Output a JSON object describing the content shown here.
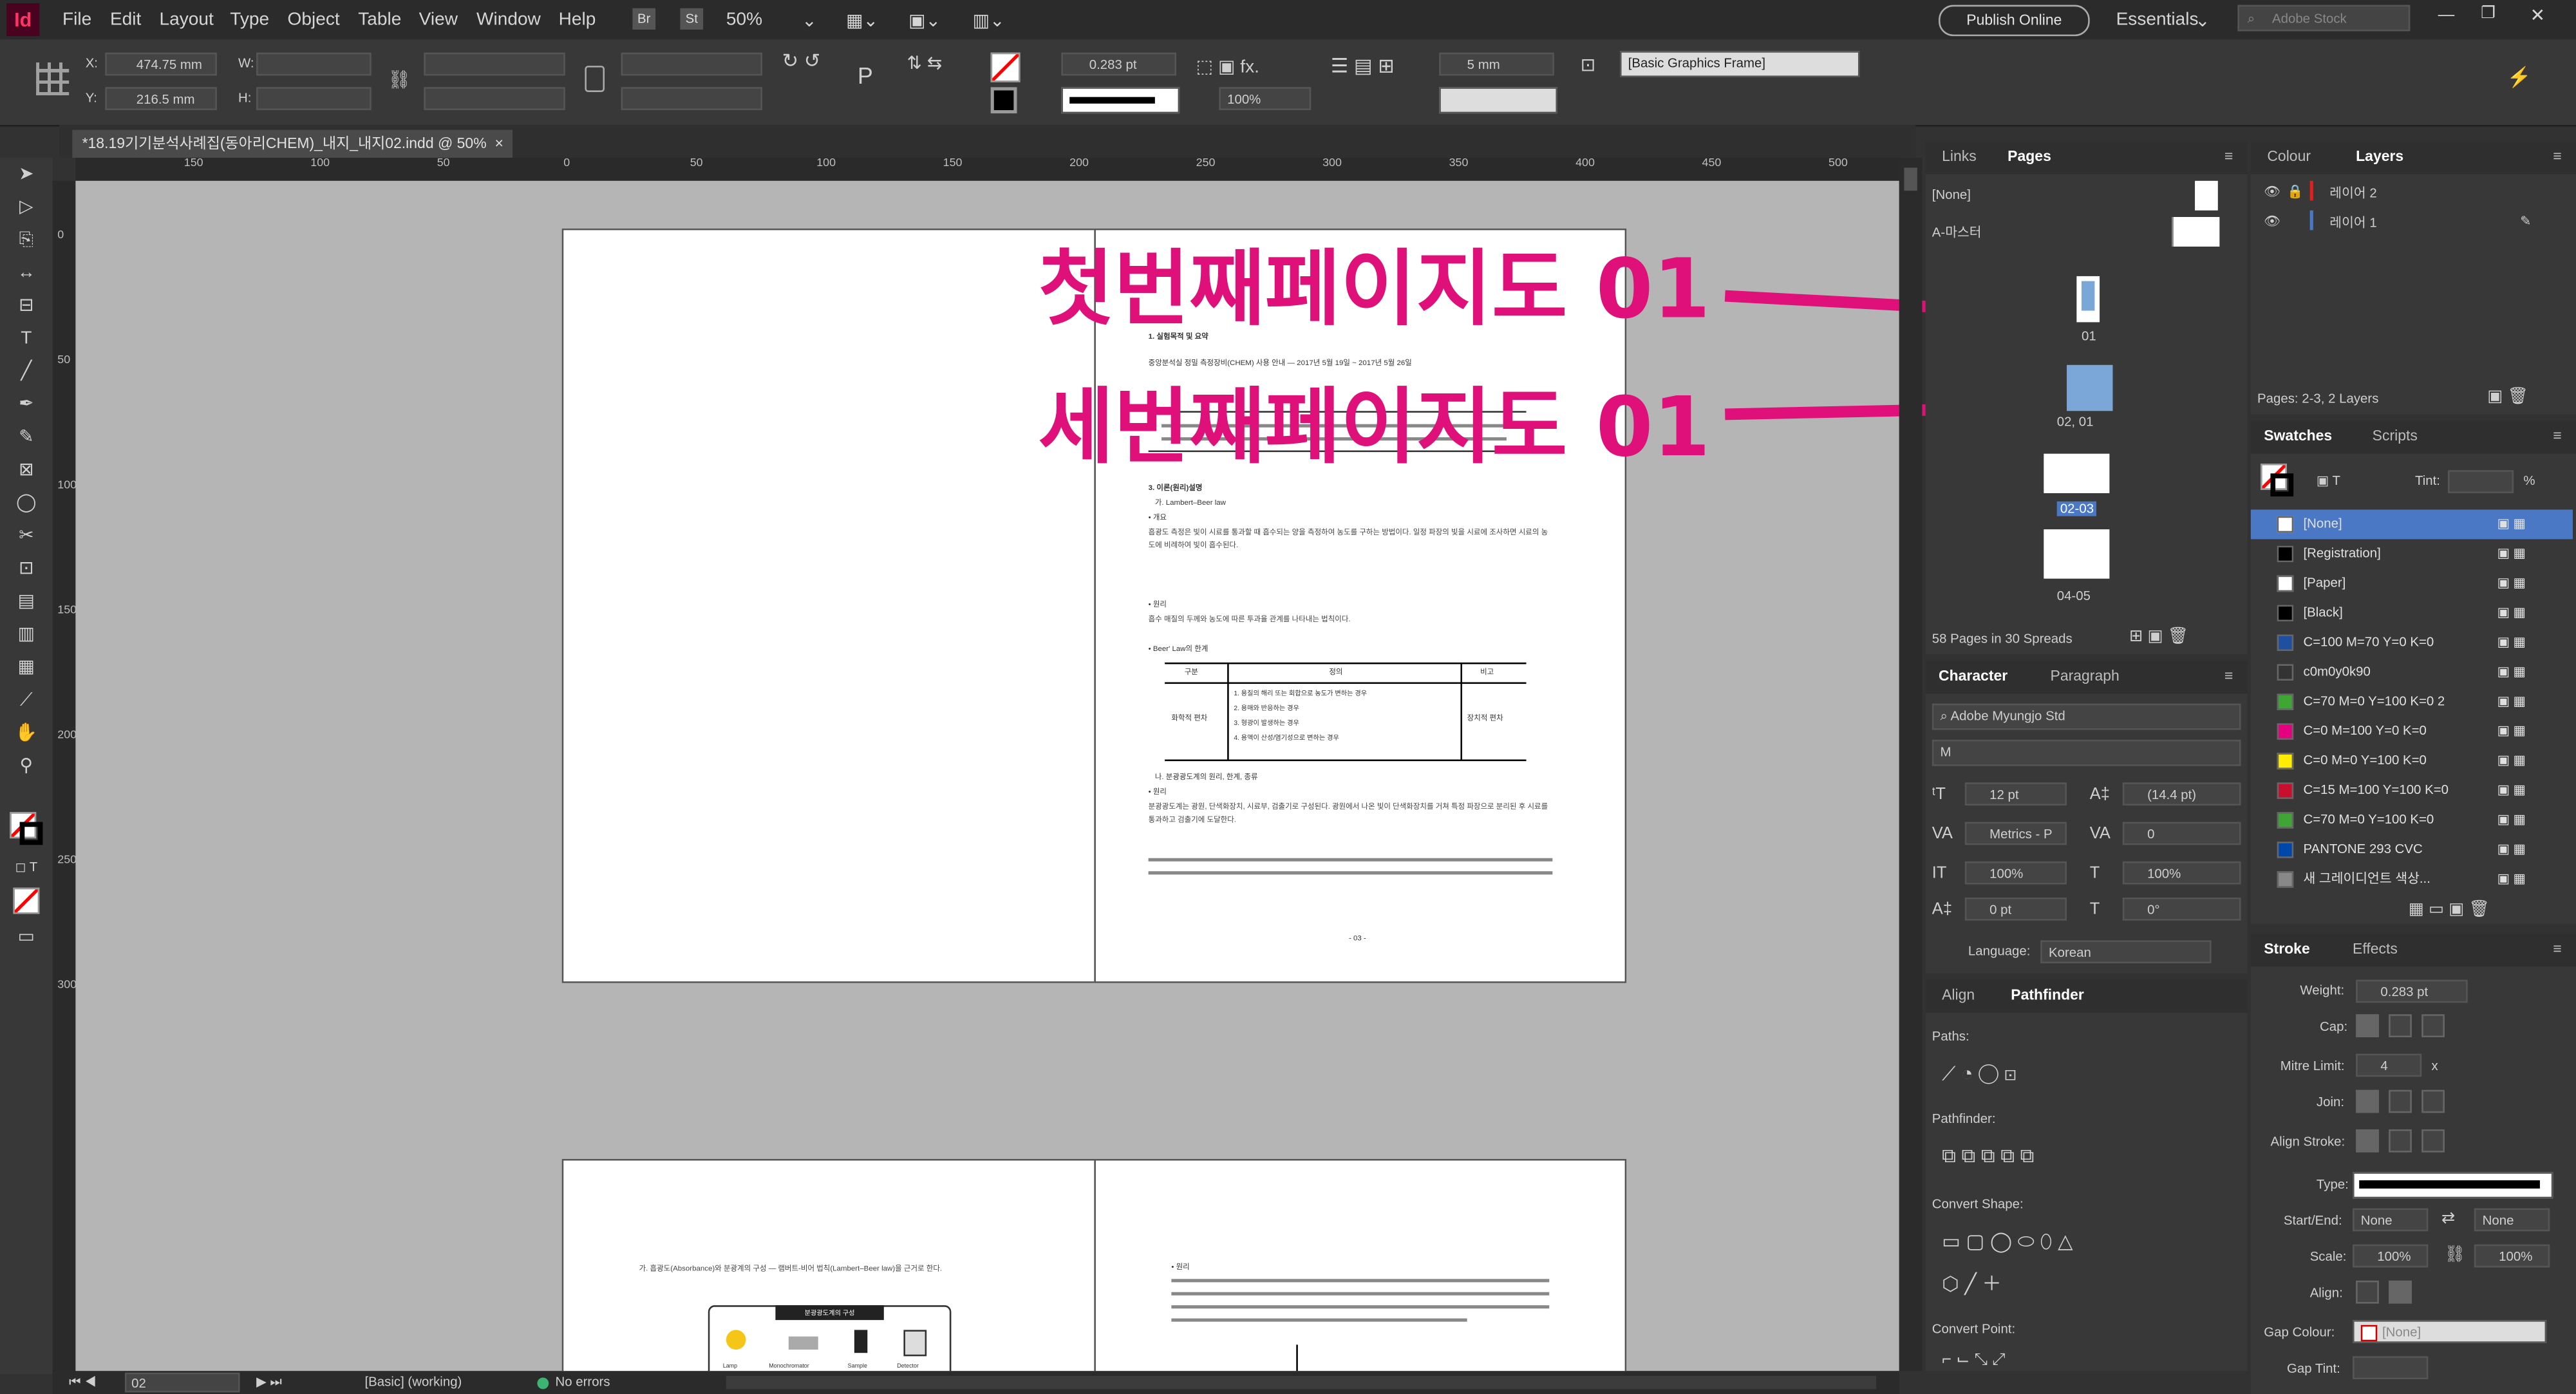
{
  "app": {
    "icon_text": "Id"
  },
  "menu": {
    "items": [
      "File",
      "Edit",
      "Layout",
      "Type",
      "Object",
      "Table",
      "View",
      "Window",
      "Help"
    ],
    "br": "Br",
    "st": "St",
    "zoom": "50%",
    "publish": "Publish Online",
    "workspace": "Essentials",
    "stock_placeholder": "Adobe Stock"
  },
  "control": {
    "x_label": "X:",
    "x_value": "474.75 mm",
    "y_label": "Y:",
    "y_value": "216.5 mm",
    "w_label": "W:",
    "h_label": "H:",
    "stroke_weight": "0.283 pt",
    "scale": "100%",
    "gap": "5 mm",
    "object_style": "[Basic Graphics Frame]"
  },
  "document": {
    "tab_title": "*18.19기기분석사례집(동아리CHEM)_내지_내지02.indd @ 50%",
    "close": "×"
  },
  "ruler": {
    "h_ticks": [
      "150",
      "100",
      "50",
      "0",
      "50",
      "100",
      "150",
      "200",
      "250",
      "300",
      "350",
      "400",
      "450",
      "500"
    ],
    "v_ticks": [
      "0",
      "50",
      "100",
      "150",
      "200",
      "250",
      "300"
    ]
  },
  "annotations": {
    "first": "첫번째페이지도 01",
    "third": "세번째페이지도 01"
  },
  "page_content": {
    "heading1": "1. 실험목적 및 요약",
    "line1": "중앙분석실 정밀 측정장비(CHEM) 사용 안내 — 2017년 5월 19일 ~ 2017년 5월 26일",
    "section": "3. 이론(원리)설명",
    "sub_a": "가. Lambert–Beer law",
    "bullet_1": "• 개요",
    "para1": "흡광도 측정은 빛이 시료를 통과할 때 흡수되는 양을 측정하여 농도를 구하는 방법이다. 일정 파장의 빛을 시료에 조사하면 시료의 농도에 비례하여 빛이 흡수된다.",
    "bullet_2": "• 원리",
    "para2": "흡수 매질의 두께와 농도에 따른 투과율 관계를 나타내는 법칙이다.",
    "bullet_3": "• Beer' Law의 한계",
    "table_headers": [
      "구분",
      "정의",
      "비고"
    ],
    "table_left": "화학적 편차",
    "table_right": "장치적 편차",
    "table_rows": [
      "1. 용질의 해리 또는 회합으로 농도가 변하는 경우",
      "2. 용매와 반응하는 경우",
      "3. 형광이 발생하는 경우",
      "4. 용액이 산성/염기성으로 변하는 경우"
    ],
    "sub_b": "나. 분광광도계의 원리, 한계, 종류",
    "bullet_4": "• 원리",
    "para3": "분광광도계는 광원, 단색화장치, 시료부, 검출기로 구성된다. 광원에서 나온 빛이 단색화장치를 거쳐 특정 파장으로 분리된 후 시료를 통과하고 검출기에 도달한다.",
    "page_num": "- 03 -",
    "lower_left": "가. 흡광도(Absorbance)와 분광계의 구성 — 램버트-비어 법칙(Lambert–Beer law)을 근거로 한다.",
    "lower_right": "• 원리",
    "figure_title": "분광광도계의 구성",
    "figure_labels": [
      "Lamp",
      "Monochromator",
      "Sample",
      "Detector"
    ]
  },
  "pages_panel": {
    "tabs": [
      "Links",
      "Pages"
    ],
    "none": "[None]",
    "master": "A-마스터",
    "thumbs": [
      "01",
      "02, 01",
      "02-03",
      "04-05"
    ],
    "footer": "58 Pages in 30 Spreads"
  },
  "layers_panel": {
    "tabs": [
      "Colour",
      "Layers"
    ],
    "layers": [
      "레이어 2",
      "레이어 1"
    ],
    "footer": "Pages: 2-3, 2 Layers"
  },
  "swatches": {
    "tabs": [
      "Swatches",
      "Scripts"
    ],
    "tint_label": "Tint:",
    "tint_unit": "%",
    "items": [
      {
        "name": "[None]",
        "color": "#ffffff"
      },
      {
        "name": "[Registration]",
        "color": "#000000"
      },
      {
        "name": "[Paper]",
        "color": "#ffffff"
      },
      {
        "name": "[Black]",
        "color": "#000000"
      },
      {
        "name": "C=100 M=70 Y=0 K=0",
        "color": "#1f4fa0"
      },
      {
        "name": "c0m0y0k90",
        "color": "#333333"
      },
      {
        "name": "C=70 M=0 Y=100 K=0 2",
        "color": "#3fa535"
      },
      {
        "name": "C=0 M=100 Y=0 K=0",
        "color": "#e4007f"
      },
      {
        "name": "C=0 M=0 Y=100 K=0",
        "color": "#ffed00"
      },
      {
        "name": "C=15 M=100 Y=100 K=0",
        "color": "#c8102e"
      },
      {
        "name": "C=70 M=0 Y=100 K=0",
        "color": "#3fa535"
      },
      {
        "name": "PANTONE 293 CVC",
        "color": "#0047ab"
      },
      {
        "name": "새 그레이디언트 색상...",
        "color": "#888888"
      }
    ]
  },
  "character": {
    "tabs": [
      "Character",
      "Paragraph"
    ],
    "font": "Adobe Myungjo Std",
    "style": "M",
    "size": "12 pt",
    "leading": "(14.4 pt)",
    "kerning": "Metrics - P",
    "tracking": "0",
    "vscale": "100%",
    "hscale": "100%",
    "baseline": "0 pt",
    "skew": "0°",
    "language_label": "Language:",
    "language": "Korean"
  },
  "align_panel": {
    "tabs": [
      "Align",
      "Pathfinder"
    ],
    "paths": "Paths:",
    "pathfinder": "Pathfinder:",
    "convert_shape": "Convert Shape:",
    "convert_point": "Convert Point:"
  },
  "stroke": {
    "tabs": [
      "Stroke",
      "Effects"
    ],
    "weight_label": "Weight:",
    "weight": "0.283 pt",
    "cap_label": "Cap:",
    "mitre_label": "Mitre Limit:",
    "mitre": "4",
    "mitre_unit": "x",
    "join_label": "Join:",
    "align_label": "Align Stroke:",
    "type_label": "Type:",
    "startend_label": "Start/End:",
    "start": "None",
    "end": "None",
    "scale_label": "Scale:",
    "scale1": "100%",
    "scale2": "100%",
    "align2_label": "Align:",
    "gapcolour_label": "Gap Colour:",
    "gapcolour": "[None]",
    "gaptint_label": "Gap Tint:"
  },
  "status": {
    "page": "02",
    "style": "[Basic] (working)",
    "errors": "No errors"
  }
}
